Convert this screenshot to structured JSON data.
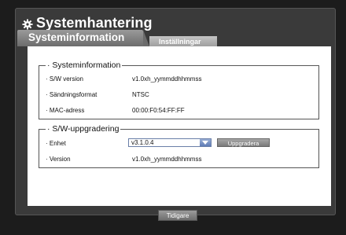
{
  "window": {
    "title": "Systemhantering",
    "icon": "gear-icon"
  },
  "tabs": [
    {
      "label": "Systeminformation",
      "active": true
    },
    {
      "label": "Inställningar",
      "active": false
    }
  ],
  "sysinfo": {
    "legend": "· Systeminformation",
    "rows": [
      {
        "label": "· S/W version",
        "value": "v1.0xh_yymmddhhmmss"
      },
      {
        "label": "· Sändningsformat",
        "value": "NTSC"
      },
      {
        "label": "· MAC-adress",
        "value": "00:00:F0:54:FF:FF"
      }
    ]
  },
  "upgrade": {
    "legend": "· S/W-uppgradering",
    "device_label": "· Enhet",
    "device_value": "v3.1.0.4",
    "upgrade_button": "Uppgradera",
    "version_label": "· Version",
    "version_value": "v1.0xh_yymmddhhmmss"
  },
  "footer": {
    "back_button": "Tidigare"
  },
  "colors": {
    "background": "#1c1c1c",
    "window": "#3a3a3a",
    "content": "#ffffff",
    "select_arrow": "#5f7cb6"
  }
}
